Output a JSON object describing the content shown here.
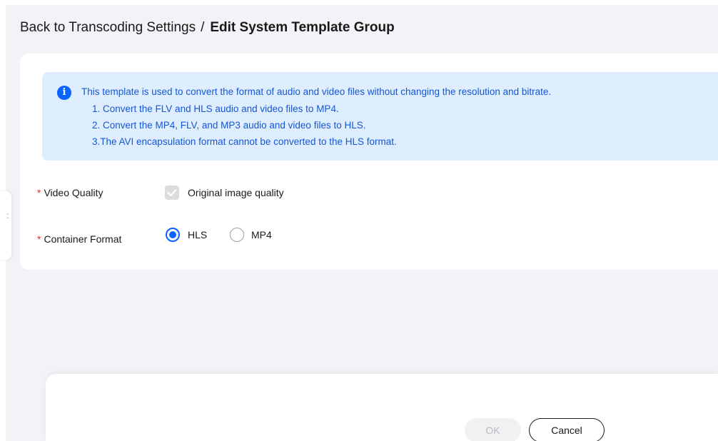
{
  "breadcrumb": {
    "back_link": "Back to Transcoding Settings",
    "separator": "/",
    "current": "Edit System Template Group"
  },
  "notice": {
    "icon": "info-icon",
    "lines": [
      "This template is used to convert the format of audio and video files without changing the resolution and bitrate.",
      "1. Convert the FLV and HLS audio and video files to MP4.",
      "2. Convert the MP4, FLV, and MP3 audio and video files to HLS.",
      "3.The AVI encapsulation format cannot be converted to the HLS format."
    ]
  },
  "form": {
    "required_mark": "*",
    "video_quality": {
      "label": "Video Quality",
      "option_label": "Original image quality",
      "checked": true,
      "disabled": true
    },
    "container_format": {
      "label": "Container Format",
      "options": [
        {
          "label": "HLS",
          "selected": true
        },
        {
          "label": "MP4",
          "selected": false
        }
      ]
    }
  },
  "footer": {
    "ok_label": "OK",
    "ok_disabled": true,
    "cancel_label": "Cancel"
  },
  "colors": {
    "accent": "#0a64ff",
    "notice_bg": "#deeeff",
    "notice_text": "#1656d4",
    "required": "#e0312e",
    "page_bg": "#f1f3f6"
  }
}
